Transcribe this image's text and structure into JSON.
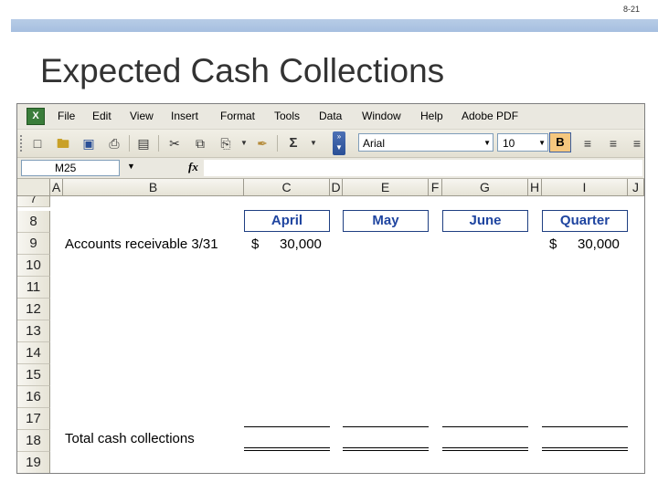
{
  "page_number": "8-21",
  "slide_title": "Expected Cash Collections",
  "menu": [
    "File",
    "Edit",
    "View",
    "Insert",
    "Format",
    "Tools",
    "Data",
    "Window",
    "Help",
    "Adobe PDF"
  ],
  "toolbar": {
    "font_name": "Arial",
    "font_size": "10",
    "bold_label": "B",
    "sigma": "Σ"
  },
  "name_box": "M25",
  "fx_label": "fx",
  "columns": [
    "A",
    "B",
    "C",
    "D",
    "E",
    "F",
    "G",
    "H",
    "I",
    "J"
  ],
  "rows": [
    "7",
    "8",
    "9",
    "10",
    "11",
    "12",
    "13",
    "14",
    "15",
    "16",
    "17",
    "18",
    "19"
  ],
  "sheet": {
    "headers": {
      "april": "April",
      "may": "May",
      "june": "June",
      "quarter": "Quarter"
    },
    "ar_label": "Accounts receivable 3/31",
    "ar_april_currency": "$",
    "ar_april_value": "30,000",
    "ar_quarter_currency": "$",
    "ar_quarter_value": "30,000",
    "total_label": "Total cash collections"
  }
}
